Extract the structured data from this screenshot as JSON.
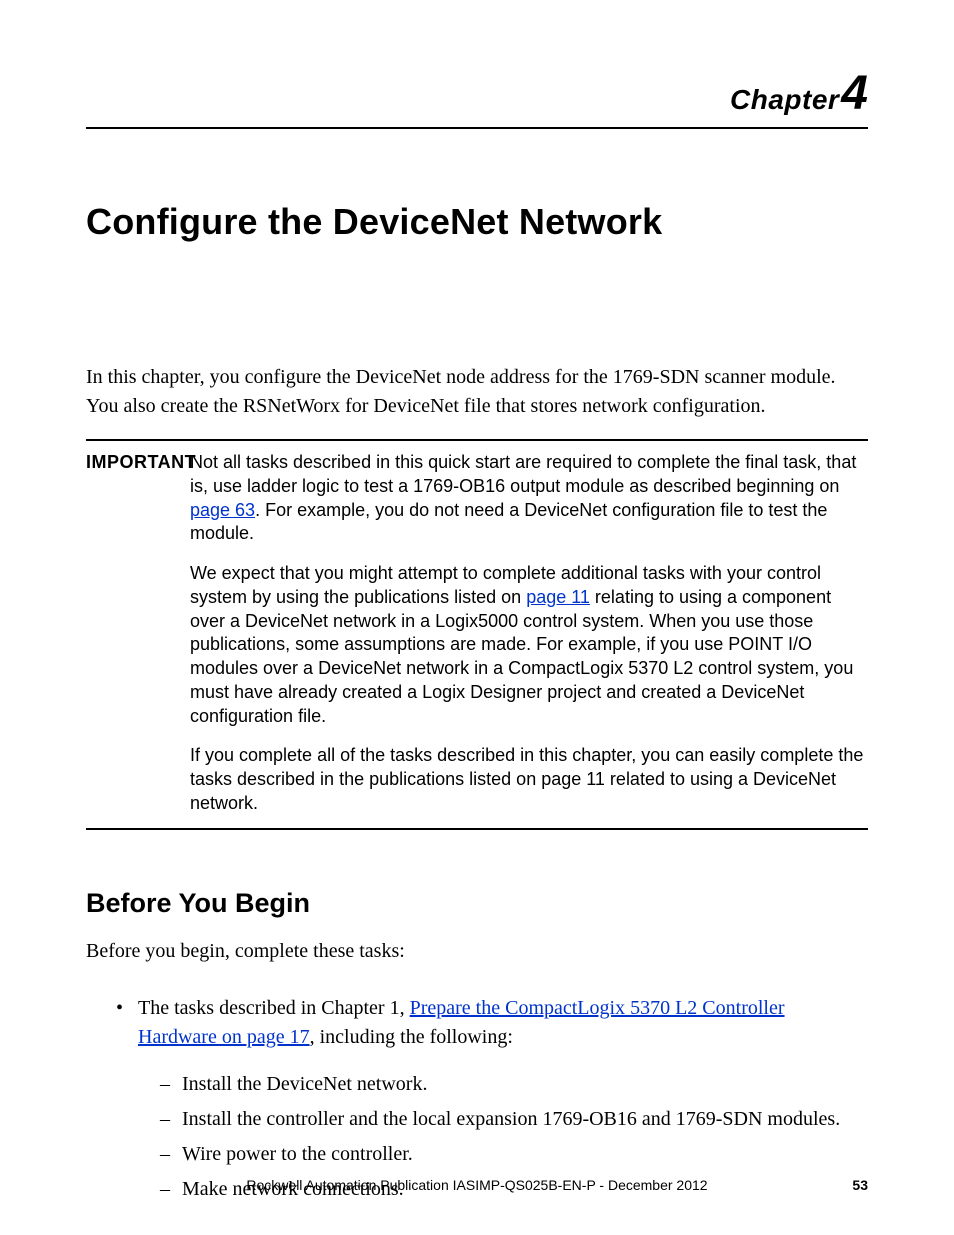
{
  "chapter": {
    "label": "Chapter",
    "number": "4"
  },
  "title": "Configure the DeviceNet Network",
  "intro": "In this chapter, you configure the DeviceNet node address for the 1769-SDN scanner module. You also create the RSNetWorx for DeviceNet file that stores network configuration.",
  "important": {
    "label": "IMPORTANT",
    "p1a": "Not all tasks described in this quick start are required to complete the final task, that is, use ladder logic to test a 1769-OB16 output module as described beginning on ",
    "p1link": "page 63",
    "p1b": ". For example, you do not need a DeviceNet configuration file to test the module.",
    "p2a": "We expect that you might attempt to complete additional tasks with your control system by using the publications listed on ",
    "p2link": "page 11",
    "p2b": " relating to using a component over a DeviceNet network in a Logix5000 control system. When you use those publications, some assumptions are made. For example, if you use POINT I/O modules over a DeviceNet network in a CompactLogix 5370 L2 control system, you must have already created a Logix Designer project and created a DeviceNet configuration file.",
    "p3": "If you complete all of the tasks described in this chapter, you can easily complete the tasks described in the publications listed on page 11 related to using a DeviceNet network."
  },
  "before": {
    "heading": "Before You Begin",
    "lead": "Before you begin, complete these tasks:",
    "bullet1a": "The tasks described in Chapter 1, ",
    "bullet1link": "Prepare the CompactLogix 5370 L2 Controller Hardware on page 17",
    "bullet1b": ", including the following:",
    "sub1": "Install the DeviceNet network.",
    "sub2": "Install the controller and the local expansion 1769-OB16 and 1769-SDN modules.",
    "sub3": "Wire power to the controller.",
    "sub4": "Make network connections."
  },
  "footer": {
    "text": "Rockwell Automation Publication IASIMP-QS025B-EN-P - December 2012",
    "page": "53"
  }
}
